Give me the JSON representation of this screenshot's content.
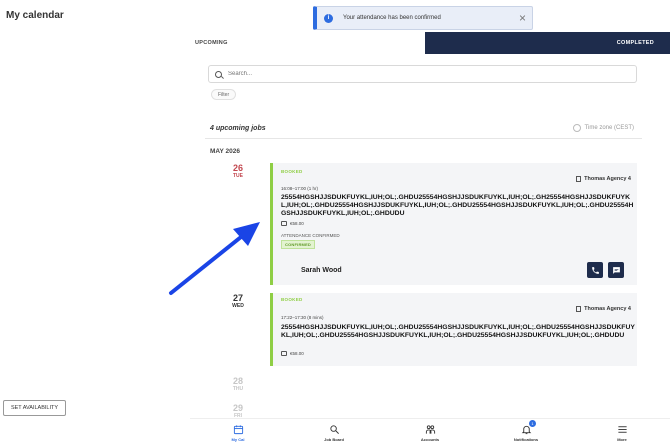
{
  "page": {
    "title": "My calendar"
  },
  "toast": {
    "message": "Your attendance has been confirmed",
    "close_icon": "×"
  },
  "tabs": {
    "upcoming": "UPCOMING",
    "completed": "COMPLETED"
  },
  "search": {
    "placeholder": "Search...",
    "value": ""
  },
  "filter": {
    "label": "Filter"
  },
  "summary": {
    "count_label": "4 upcoming jobs",
    "timezone": "Time zone (CEST)"
  },
  "month": "MAY 2026",
  "days": [
    {
      "num": "26",
      "dow": "TUE"
    },
    {
      "num": "27",
      "dow": "WED"
    },
    {
      "num": "28",
      "dow": "THU"
    },
    {
      "num": "29",
      "dow": "FRI"
    }
  ],
  "jobs": [
    {
      "status": "BOOKED",
      "agency": "Thomas Agency 4",
      "time": "16:08–17:00 (1 hr)",
      "title": "25554HGSHJJSDUKFUYKL,IUH;OL;.GHDU25554HGSHJJSDUKFUYKL,IUH;OL;.GH25554HGSHJJSDUKFUYKL,IUH;OL;.GHDU25554HGSHJJSDUKFUYKL,IUH;OL;.GHDU25554HGSHJJSDUKFUYKL,IUH;OL;.GHDU25554HGSHJJSDUKFUYKL,IUH;OL;.GHDUDU",
      "pay": "€58.00",
      "attendance_label": "ATTENDANCE CONFIRMED",
      "attendance_chip": "CONFIRMED",
      "person": "Sarah Wood"
    },
    {
      "status": "BOOKED",
      "agency": "Thomas Agency 4",
      "time": "17:22–17:30 (8 mins)",
      "title": "25554HGSHJJSDUKFUYKL,IUH;OL;.GHDU25554HGSHJJSDUKFUYKL,IUH;OL;.GHDU25554HGSHJJSDUKFUYKL,IUH;OL;.GHDU25554HGSHJJSDUKFUYKL,IUH;OL;.GHDU25554HGSHJJSDUKFUYKL,IUH;OL;.GHDUDU",
      "pay": "€58.00"
    }
  ],
  "set_availability": "SET AVAILABILITY",
  "nav": [
    {
      "label": "My Cal",
      "icon": "calendar-icon"
    },
    {
      "label": "Job Board",
      "icon": "search-icon"
    },
    {
      "label": "Accounts",
      "icon": "accounts-icon"
    },
    {
      "label": "Notifications",
      "icon": "bell-icon",
      "badge": "1"
    },
    {
      "label": "More",
      "icon": "menu-icon"
    }
  ],
  "colors": {
    "navy": "#1e2c4c",
    "accent": "#2d6ce0",
    "booked_green": "#8fce45",
    "date_red": "#c2474f",
    "arrow": "#1a44e6"
  }
}
